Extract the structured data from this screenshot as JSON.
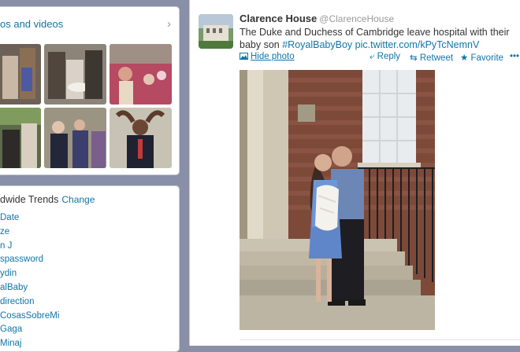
{
  "sidebar": {
    "photos": {
      "header": "os and videos",
      "chevron_icon": "chevron-right-icon"
    },
    "trends": {
      "header": "dwide Trends",
      "change_label": "Change",
      "items": [
        "Date",
        "ze",
        "n J",
        "spassword",
        "ydin",
        "alBaby",
        "direction",
        "CosasSobreMi",
        "Gaga",
        "Minaj"
      ]
    }
  },
  "tweet": {
    "display_name": "Clarence House",
    "handle": "@ClarenceHouse",
    "text_plain": "The Duke and Duchess of Cambridge leave hospital with their baby son ",
    "hashtag": "#RoyalBabyBoy",
    "link": "pic.twitter.com/kPyTcNemnV",
    "actions": {
      "hide_photo": "Hide photo",
      "reply": "Reply",
      "retweet": "Retweet",
      "favorite": "Favorite",
      "more": "•••"
    },
    "icons": {
      "photo": "photo-icon",
      "reply": "reply-arrow-icon",
      "retweet": "retweet-icon",
      "favorite": "star-icon",
      "more": "more-dots-icon"
    }
  },
  "colors": {
    "link": "#0f75a8",
    "background": "#8a8fa8"
  }
}
